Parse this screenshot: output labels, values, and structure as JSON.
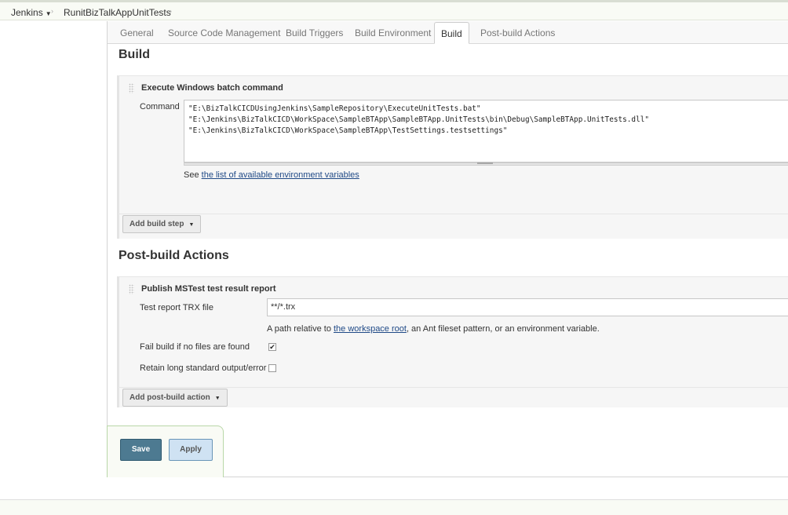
{
  "breadcrumb": {
    "root": "Jenkins",
    "job": "RunitBizTalkAppUnitTests"
  },
  "tabs": [
    "General",
    "Source Code Management",
    "Build Triggers",
    "Build Environment",
    "Build",
    "Post-build Actions"
  ],
  "active_tab": "Build",
  "build": {
    "title": "Build",
    "step_title": "Execute Windows batch command",
    "command_label": "Command",
    "command_lines": [
      "\"E:\\BizTalkCICDUsingJenkins\\SampleRepository\\ExecuteUnitTests.bat\"",
      "\"E:\\Jenkins\\BizTalkCICD\\WorkSpace\\SampleBTApp\\SampleBTApp.UnitTests\\bin\\Debug\\SampleBTApp.UnitTests.dll\"",
      "\"E:\\Jenkins\\BizTalkCICD\\WorkSpace\\SampleBTApp\\TestSettings.testsettings\""
    ],
    "help_prefix": "See ",
    "help_link": "the list of available environment variables",
    "add_button": "Add build step"
  },
  "post_build": {
    "title": "Post-build Actions",
    "step_title": "Publish MSTest test result report",
    "trx_label": "Test report TRX file",
    "trx_value": "**/*.trx",
    "help_prefix": "A path relative to ",
    "help_link": "the workspace root",
    "help_suffix": ", an Ant fileset pattern, or an environment variable.",
    "fail_label": "Fail build if no files are found",
    "fail_checked": true,
    "retain_label": "Retain long standard output/error",
    "retain_checked": false,
    "add_button": "Add post-build action"
  },
  "actions": {
    "save": "Save",
    "apply": "Apply"
  }
}
